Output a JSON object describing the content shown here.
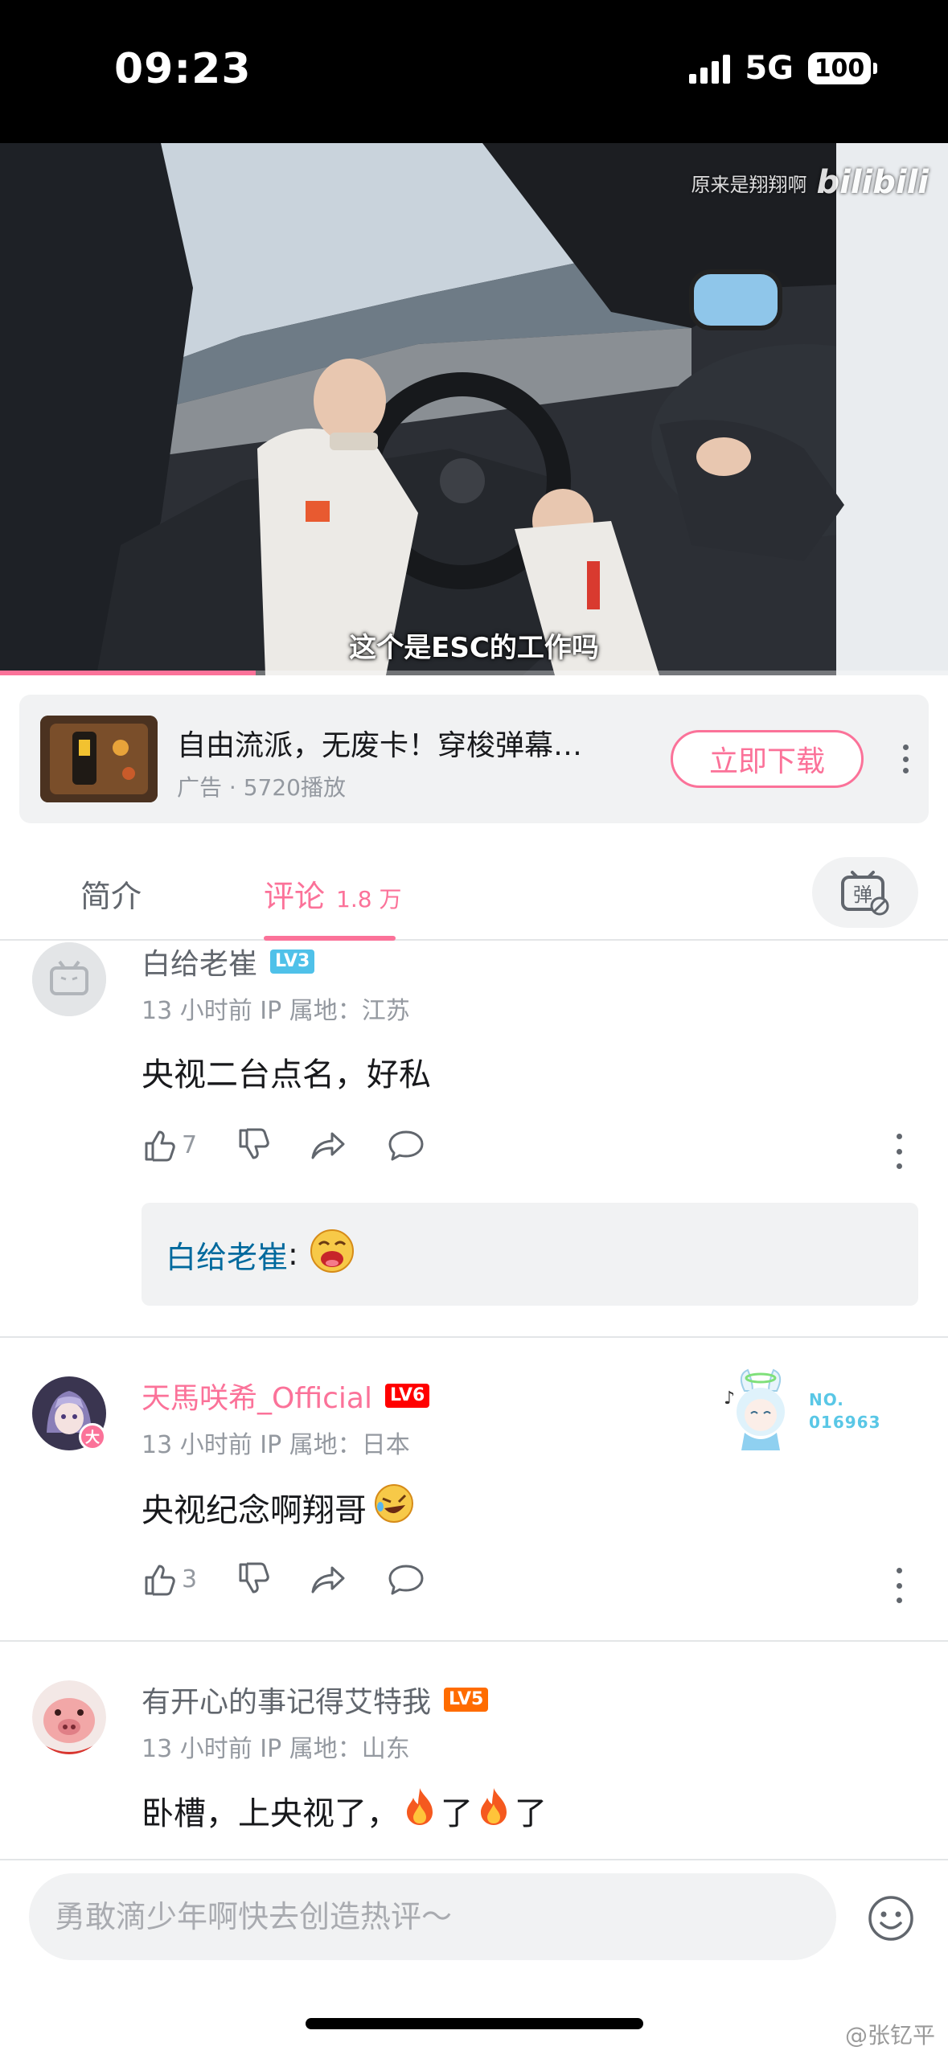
{
  "status_bar": {
    "time": "09:23",
    "network": "5G",
    "battery": "100"
  },
  "video": {
    "subtitle": "这个是ESC的工作吗",
    "watermark_channel": "原来是翔翔啊",
    "watermark_brand": "bilibili",
    "progress": 0.27
  },
  "ad": {
    "title": "自由流派，无废卡！穿梭弹幕…",
    "meta": "广告 · 5720播放",
    "cta": "立即下载",
    "more_icon": "more-vertical-icon"
  },
  "tabs": {
    "intro": "简介",
    "comments": "评论",
    "comments_count": "1.8 万",
    "danmaku_icon": "danmaku-toggle-icon",
    "danmaku_glyph": "弹"
  },
  "comments": [
    {
      "username": "白给老崔",
      "level": "LV3",
      "time": "13 小时前",
      "ip": "IP 属地：江苏",
      "text": "央视二台点名，好私",
      "likes": "7",
      "reply": {
        "name": "白给老崔",
        "suffix": ":"
      }
    },
    {
      "username": "天馬咲希_Official",
      "level": "LV6",
      "time": "13 小时前",
      "ip": "IP 属地：日本",
      "text": "央视纪念啊翔哥",
      "likes": "3",
      "avatar_badge": "大",
      "fan_badge": {
        "label": "NO.",
        "number": "016963"
      }
    },
    {
      "username": "有开心的事记得艾特我",
      "level": "LV5",
      "time": "13 小时前",
      "ip": "IP 属地：山东",
      "text_parts": [
        "卧槽，上央视了，",
        "了",
        "了"
      ]
    }
  ],
  "comment_input": {
    "placeholder": "勇敢滴少年啊快去创造热评～"
  },
  "footer_watermark": "@张钇平",
  "colors": {
    "accent": "#fb7299",
    "reply_name": "#00699d",
    "lv3": "#4fc1e9",
    "lv5": "#ff6c00",
    "lv6": "#ff0000"
  }
}
